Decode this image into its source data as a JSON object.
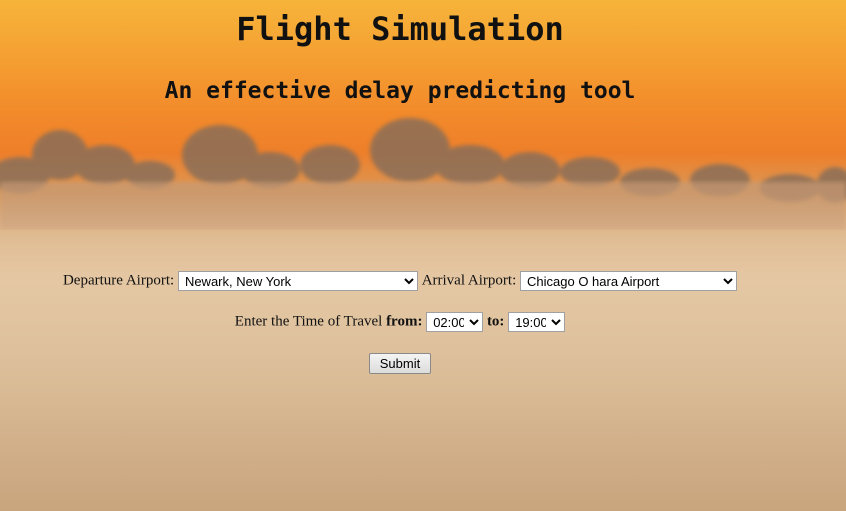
{
  "header": {
    "title": "Flight Simulation",
    "subtitle": "An effective delay predicting tool"
  },
  "form": {
    "departure_label": "Departure Airport:",
    "departure_value": "Newark, New York",
    "arrival_label": "Arrival Airport:",
    "arrival_value": "Chicago O hara Airport",
    "time_label": "Enter the Time of Travel",
    "from_label": "from:",
    "from_value": "02:00",
    "to_label": "to:",
    "to_value": "19:00",
    "submit_label": "Submit"
  },
  "colors": {
    "sky_top": "#f5a233",
    "sky_orange": "#ee7f2a",
    "haze": "#dcbd98"
  }
}
